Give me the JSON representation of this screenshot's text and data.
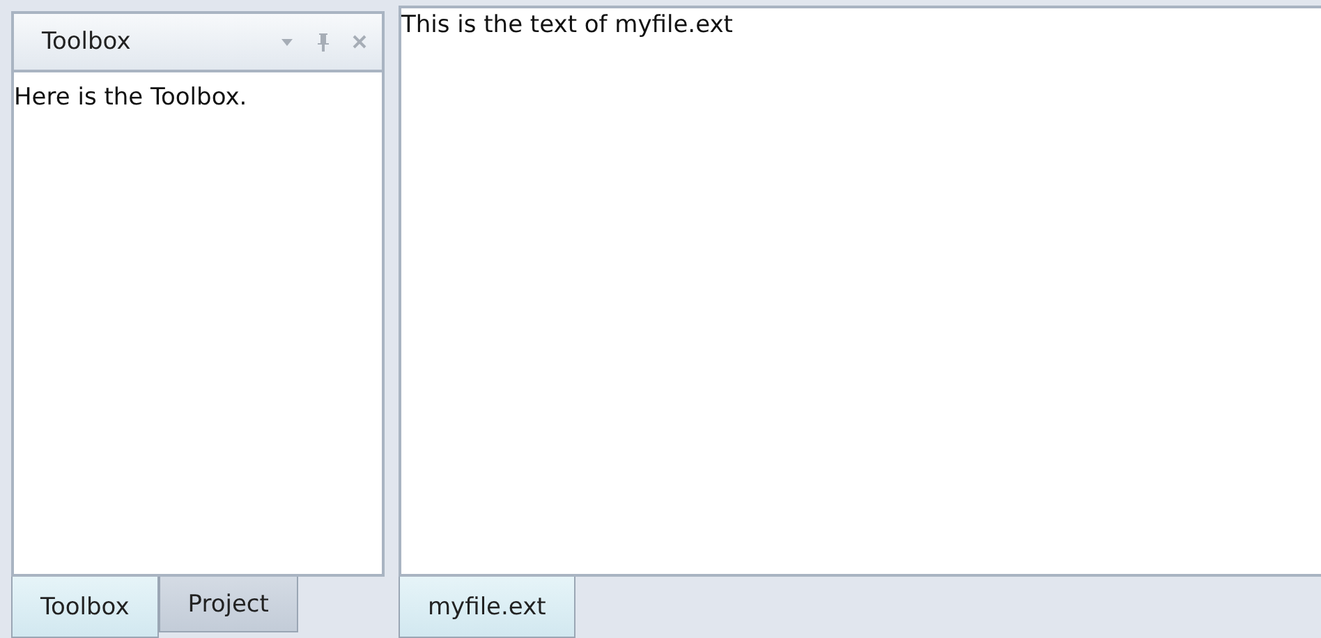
{
  "tool_pane": {
    "title": "Toolbox",
    "content": "Here is the Toolbox.",
    "tabs": [
      {
        "label": "Toolbox",
        "selected": true
      },
      {
        "label": "Project",
        "selected": false
      }
    ]
  },
  "document_pane": {
    "content": "This is the text of myfile.ext",
    "tabs": [
      {
        "label": "myfile.ext",
        "selected": true
      }
    ]
  }
}
